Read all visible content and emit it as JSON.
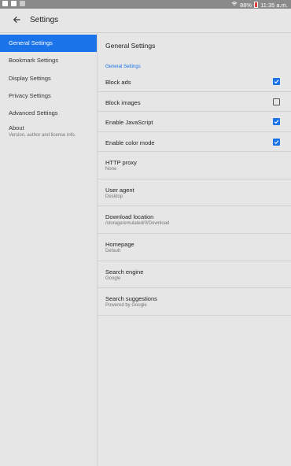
{
  "status_bar": {
    "battery": "88%",
    "time": "11:35 a.m."
  },
  "toolbar": {
    "title": "Settings",
    "back_icon": "arrow-back-icon"
  },
  "sidebar": {
    "items": [
      {
        "label": "General Settings",
        "active": true
      },
      {
        "label": "Bookmark Settings"
      },
      {
        "label": "Display Settings"
      },
      {
        "label": "Privacy Settings"
      },
      {
        "label": "Advanced Settings"
      }
    ],
    "about": {
      "label": "About",
      "summary": "Version, author and license info."
    }
  },
  "content": {
    "title": "General Settings",
    "section": "General Settings",
    "checkbox_rows": [
      {
        "label": "Block ads",
        "checked": true
      },
      {
        "label": "Block images",
        "checked": false
      },
      {
        "label": "Enable JavaScript",
        "checked": true
      },
      {
        "label": "Enable color mode",
        "checked": true
      }
    ],
    "detail_rows": [
      {
        "label": "HTTP proxy",
        "value": "None"
      },
      {
        "label": "User agent",
        "value": "Desktop"
      },
      {
        "label": "Download location",
        "value": "/storage/emulated/0/Download"
      },
      {
        "label": "Homepage",
        "value": "Default"
      },
      {
        "label": "Search engine",
        "value": "Google"
      },
      {
        "label": "Search suggestions",
        "value": "Powered by Google"
      }
    ]
  },
  "colors": {
    "accent": "#1a73e8",
    "background": "#e6e6e6",
    "status_bar": "#8a8a8a"
  }
}
